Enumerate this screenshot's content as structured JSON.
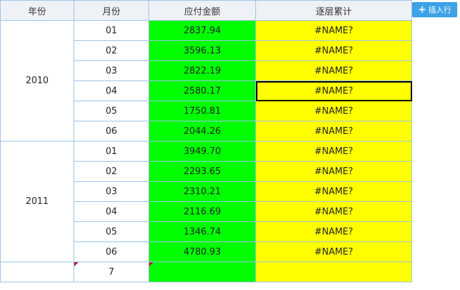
{
  "headers": {
    "year": "年份",
    "month": "月份",
    "amount": "应付金额",
    "cumulative": "逐层累计"
  },
  "insert_button": {
    "icon": "plus-icon",
    "label": "插入行"
  },
  "colors": {
    "amount_fill": "#00ff00",
    "cumulative_fill": "#ffff00",
    "grid": "#9cc4ea",
    "header_bg": "#eef1f6",
    "button_bg": "#3da2e6"
  },
  "groups": [
    {
      "year": "2010",
      "rows": [
        {
          "month": "01",
          "amount": "2837.94",
          "cumulative": "#NAME?"
        },
        {
          "month": "02",
          "amount": "3596.13",
          "cumulative": "#NAME?"
        },
        {
          "month": "03",
          "amount": "2822.19",
          "cumulative": "#NAME?"
        },
        {
          "month": "04",
          "amount": "2580.17",
          "cumulative": "#NAME?"
        },
        {
          "month": "05",
          "amount": "1750.81",
          "cumulative": "#NAME?"
        },
        {
          "month": "06",
          "amount": "2044.26",
          "cumulative": "#NAME?"
        }
      ]
    },
    {
      "year": "2011",
      "rows": [
        {
          "month": "01",
          "amount": "3949.70",
          "cumulative": "#NAME?"
        },
        {
          "month": "02",
          "amount": "2293.65",
          "cumulative": "#NAME?"
        },
        {
          "month": "03",
          "amount": "2310.21",
          "cumulative": "#NAME?"
        },
        {
          "month": "04",
          "amount": "2116.69",
          "cumulative": "#NAME?"
        },
        {
          "month": "05",
          "amount": "1346.74",
          "cumulative": "#NAME?"
        },
        {
          "month": "06",
          "amount": "4780.93",
          "cumulative": "#NAME?"
        }
      ]
    }
  ],
  "new_row": {
    "year": "",
    "month": "7",
    "amount": "",
    "cumulative": ""
  },
  "selected_cell": {
    "group": 0,
    "row": 3,
    "column": "cumulative"
  }
}
